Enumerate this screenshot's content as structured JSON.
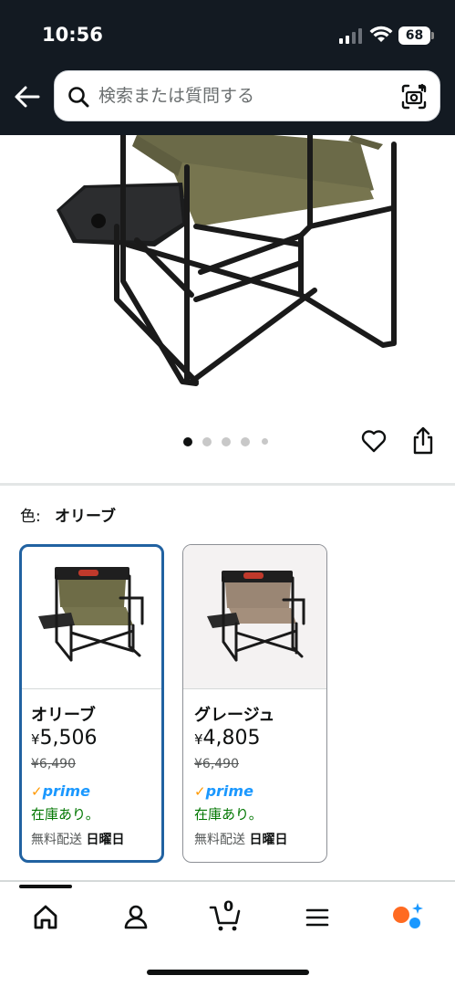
{
  "status_bar": {
    "time": "10:56",
    "battery": "68"
  },
  "search": {
    "placeholder": "検索または質問する"
  },
  "gallery": {
    "image_count": 5,
    "active_index": 0
  },
  "variant": {
    "label": "色:",
    "selected": "オリーブ"
  },
  "options": [
    {
      "name": "オリーブ",
      "price_symbol": "¥",
      "price": "5,506",
      "list_price": "¥6,490",
      "prime_check": "✓",
      "prime_word": "prime",
      "stock": "在庫あり。",
      "delivery_label": "無料配送",
      "delivery_day": "日曜日"
    },
    {
      "name": "グレージュ",
      "price_symbol": "¥",
      "price": "4,805",
      "list_price": "¥6,490",
      "prime_check": "✓",
      "prime_word": "prime",
      "stock": "在庫あり。",
      "delivery_label": "無料配送",
      "delivery_day": "日曜日"
    }
  ],
  "tabbar": {
    "items": [
      "home-icon",
      "account-icon",
      "cart-icon",
      "menu-icon",
      "rufus-icon"
    ],
    "cart_count": "0"
  },
  "colors": {
    "header": "#131a22",
    "selected_border": "#2162a1",
    "stock": "#007600",
    "prime": "#1a98ff",
    "prime_check": "#ff9900"
  }
}
